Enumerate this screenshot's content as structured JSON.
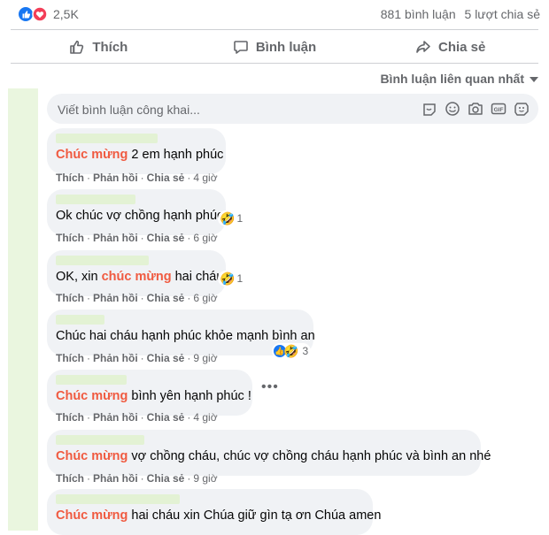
{
  "post": {
    "reaction_count": "2,5K",
    "comments_count": "881 bình luận",
    "shares_count": "5 lượt chia sẻ"
  },
  "actions": [
    {
      "label": "Thích",
      "icon": "like-icon"
    },
    {
      "label": "Bình luận",
      "icon": "comment-icon"
    },
    {
      "label": "Chia sẻ",
      "icon": "share-icon"
    }
  ],
  "sort_label": "Bình luận liên quan nhất",
  "comment_input": {
    "placeholder": "Viết bình luận công khai...",
    "icons": [
      "sticker-icon",
      "emoji-icon",
      "camera-icon",
      "gif-icon",
      "avatar-sticker-icon"
    ]
  },
  "meta_labels": {
    "like": "Thích",
    "reply": "Phản hồi",
    "share": "Chia sẻ"
  },
  "comments": [
    {
      "text_before": "",
      "highlight": "Chúc mừng",
      "text_after": " 2 em hạnh phúc",
      "time": "4 giờ",
      "reaction": null
    },
    {
      "text_before": "Ok chúc vợ chồng hạnh phúc",
      "highlight": "",
      "text_after": "",
      "time": "6 giờ",
      "reaction": {
        "icons": [
          "haha-icon"
        ],
        "count": "1"
      }
    },
    {
      "text_before": "OK, xin ",
      "highlight": "chúc mừng",
      "text_after": " hai cháu",
      "time": "6 giờ",
      "reaction": {
        "icons": [
          "haha-icon"
        ],
        "count": "1"
      }
    },
    {
      "text_before": "Chúc hai cháu hạnh phúc khỏe mạnh bình an",
      "highlight": "",
      "text_after": "",
      "time": "9 giờ",
      "reaction": {
        "icons": [
          "like-icon",
          "haha-icon"
        ],
        "count": "3"
      }
    },
    {
      "text_before": "",
      "highlight": "Chúc mừng",
      "text_after": " bình yên hạnh phúc !",
      "time": "4 giờ",
      "reaction": null
    },
    {
      "text_before": "",
      "highlight": "Chúc mừng",
      "text_after": " vợ chồng cháu, chúc vợ chồng cháu hạnh phúc và bình an nhé",
      "time": "9 giờ",
      "reaction": null
    },
    {
      "text_before": "",
      "highlight": "Chúc mừng",
      "text_after": " hai cháu xin Chúa giữ gìn tạ ơn Chúa amen",
      "time": "",
      "reaction": null
    }
  ],
  "more_options": "•••"
}
